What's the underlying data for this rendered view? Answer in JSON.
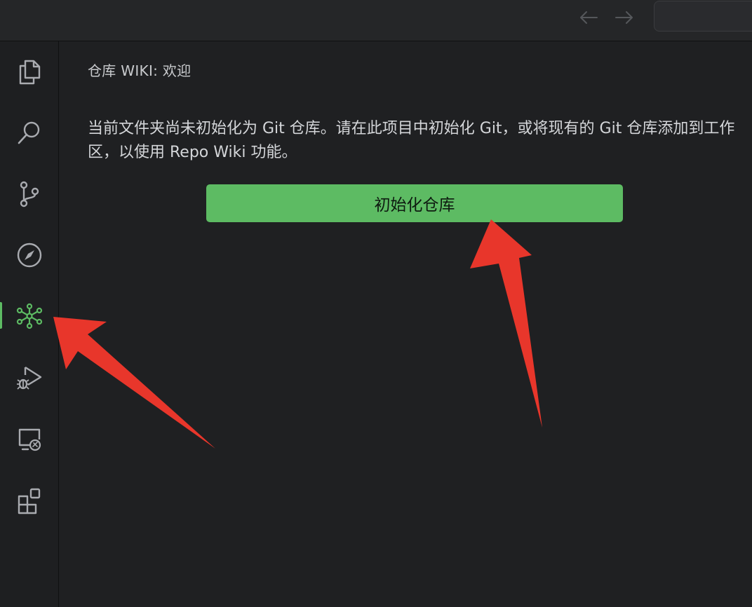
{
  "titlebar": {
    "back_icon": "arrow-left-icon",
    "forward_icon": "arrow-right-icon"
  },
  "activity_bar": {
    "items": [
      {
        "icon": "explorer-files-icon"
      },
      {
        "icon": "search-icon"
      },
      {
        "icon": "source-control-icon"
      },
      {
        "icon": "compass-icon"
      },
      {
        "icon": "repo-wiki-icon",
        "active": true
      },
      {
        "icon": "run-debug-icon"
      },
      {
        "icon": "remote-explorer-icon"
      },
      {
        "icon": "extensions-icon"
      }
    ],
    "active_color": "#5dbb63"
  },
  "panel": {
    "title": "仓库 WIKI: 欢迎",
    "message": "当前文件夹尚未初始化为 Git 仓库。请在此项目中初始化 Git，或将现有的 Git 仓库添加到工作区，以使用 Repo Wiki 功能。",
    "button_label": "初始化仓库",
    "button_color": "#5dbb63"
  },
  "annotation_color": "#e8362b"
}
